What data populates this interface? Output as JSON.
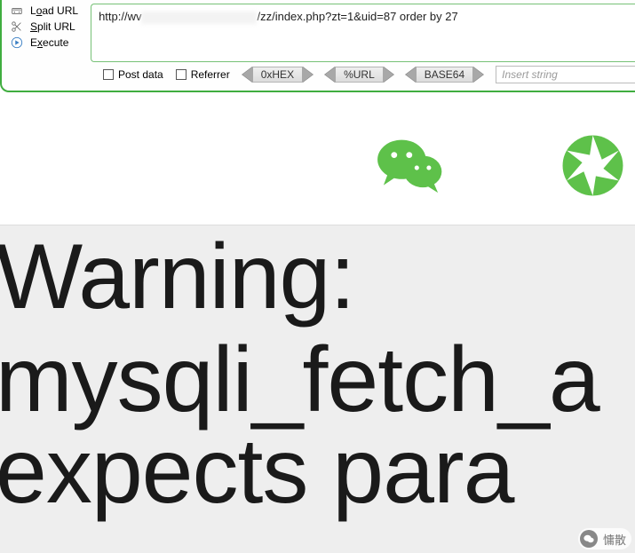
{
  "side": {
    "load": "Load URL",
    "split": "Split URL",
    "execute": "Execute",
    "load_u": "o",
    "split_u": "S",
    "execute_u": "x"
  },
  "url": {
    "prefix": "http://wv",
    "suffix": "/zz/index.php?zt=1&uid=87 order by 27"
  },
  "opts": {
    "post": "Post data",
    "referrer": "Referrer"
  },
  "tags": {
    "hex": "0xHEX",
    "url": "%URL",
    "b64": "BASE64"
  },
  "insert_placeholder": "Insert string",
  "error": {
    "line1": "Warning:",
    "line2": "mysqli_fetch_a",
    "line3": "expects para"
  },
  "watermark": "慵散"
}
